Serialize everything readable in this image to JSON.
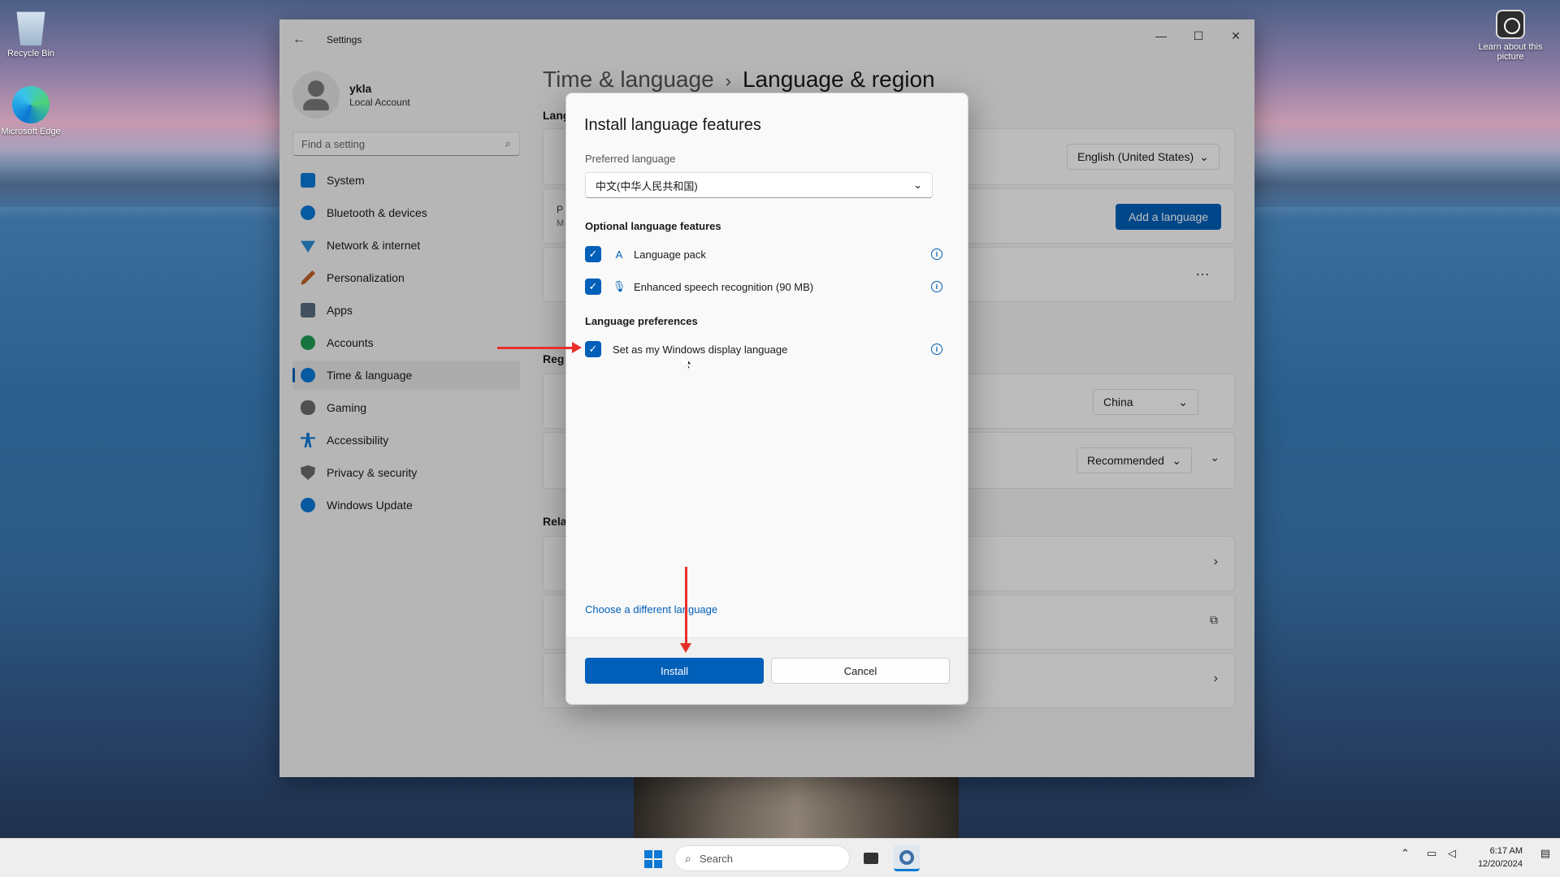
{
  "desktop": {
    "recycle_bin": "Recycle Bin",
    "edge": "Microsoft Edge",
    "learn": "Learn about this picture"
  },
  "window": {
    "title": "Settings",
    "back_icon": "back-arrow-icon"
  },
  "profile": {
    "name": "ykla",
    "account": "Local Account"
  },
  "search": {
    "placeholder": "Find a setting"
  },
  "nav": [
    {
      "label": "System",
      "icon": "system-icon",
      "color": "#0a78d4"
    },
    {
      "label": "Bluetooth & devices",
      "icon": "bluetooth-icon",
      "color": "#0a78d4"
    },
    {
      "label": "Network & internet",
      "icon": "wifi-icon",
      "color": "#2a8bd6"
    },
    {
      "label": "Personalization",
      "icon": "brush-icon",
      "color": "#c0622a"
    },
    {
      "label": "Apps",
      "icon": "apps-icon",
      "color": "#5a6b7c"
    },
    {
      "label": "Accounts",
      "icon": "accounts-icon",
      "color": "#1f9d55"
    },
    {
      "label": "Time & language",
      "icon": "globe-clock-icon",
      "color": "#0a78d4",
      "active": true
    },
    {
      "label": "Gaming",
      "icon": "gaming-icon",
      "color": "#6b6b6b"
    },
    {
      "label": "Accessibility",
      "icon": "accessibility-icon",
      "color": "#0a78d4"
    },
    {
      "label": "Privacy & security",
      "icon": "shield-icon",
      "color": "#6b6b6b"
    },
    {
      "label": "Windows Update",
      "icon": "update-icon",
      "color": "#0a78d4"
    }
  ],
  "page": {
    "breadcrumb_parent": "Time & language",
    "breadcrumb_sep": "›",
    "title": "Language & region",
    "section_language": "Lang",
    "section_region": "Reg",
    "section_related": "Rela",
    "display_language": "English (United States)",
    "add_language": "Add a language",
    "row_p": "P",
    "row_m": "M",
    "country": "China",
    "regional_format": "Recommended",
    "more_icon": "ellipsis-icon"
  },
  "dialog": {
    "title": "Install language features",
    "preferred_label": "Preferred language",
    "preferred_value": "中文(中华人民共和国)",
    "optional_heading": "Optional language features",
    "options": [
      {
        "label": "Language pack",
        "icon": "language-pack-icon",
        "checked": true
      },
      {
        "label": "Enhanced speech recognition (90 MB)",
        "icon": "microphone-icon",
        "checked": true
      }
    ],
    "prefs_heading": "Language preferences",
    "display_pref": {
      "label": "Set as my Windows display language",
      "checked": true
    },
    "choose_link": "Choose a different language",
    "install": "Install",
    "cancel": "Cancel"
  },
  "taskbar": {
    "search": "Search",
    "time": "6:17 AM",
    "date": "12/20/2024"
  },
  "colors": {
    "accent": "#005fb8",
    "annotation": "#e8302a"
  }
}
